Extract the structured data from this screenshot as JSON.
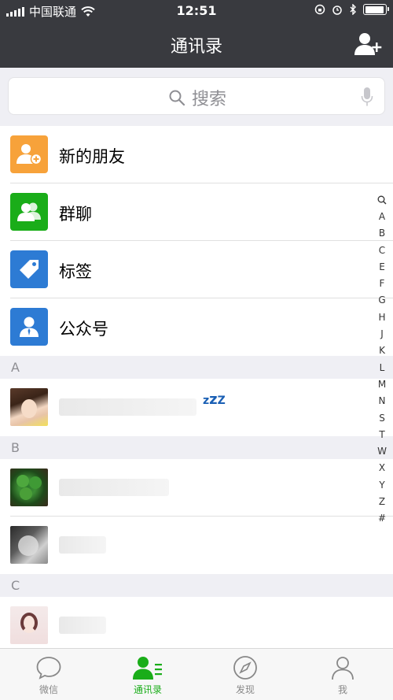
{
  "status_bar": {
    "carrier": "中国联通",
    "time": "12:51",
    "battery_level": 0.95
  },
  "navbar": {
    "title": "通讯录",
    "add_icon": "add-friend-icon"
  },
  "search": {
    "placeholder": "搜索"
  },
  "features": [
    {
      "label": "新的朋友",
      "icon": "new-friend-icon",
      "color": "#f7a23a"
    },
    {
      "label": "群聊",
      "icon": "group-chat-icon",
      "color": "#1aad19"
    },
    {
      "label": "标签",
      "icon": "tag-icon",
      "color": "#2d7bd4"
    },
    {
      "label": "公众号",
      "icon": "official-account-icon",
      "color": "#2d7bd4"
    }
  ],
  "sections": [
    {
      "letter": "A"
    },
    {
      "letter": "B"
    },
    {
      "letter": "C"
    }
  ],
  "index_letters": [
    "A",
    "B",
    "C",
    "E",
    "F",
    "G",
    "H",
    "J",
    "K",
    "L",
    "M",
    "N",
    "S",
    "T",
    "W",
    "X",
    "Y",
    "Z",
    "#"
  ],
  "tabs": [
    {
      "label": "微信",
      "icon": "chat-bubble-icon",
      "active": false
    },
    {
      "label": "通讯录",
      "icon": "contacts-icon",
      "active": true
    },
    {
      "label": "发现",
      "icon": "compass-icon",
      "active": false
    },
    {
      "label": "我",
      "icon": "me-icon",
      "active": false
    }
  ],
  "colors": {
    "accent": "#1aad19",
    "navbar": "#393a3f",
    "background": "#efeff4"
  }
}
